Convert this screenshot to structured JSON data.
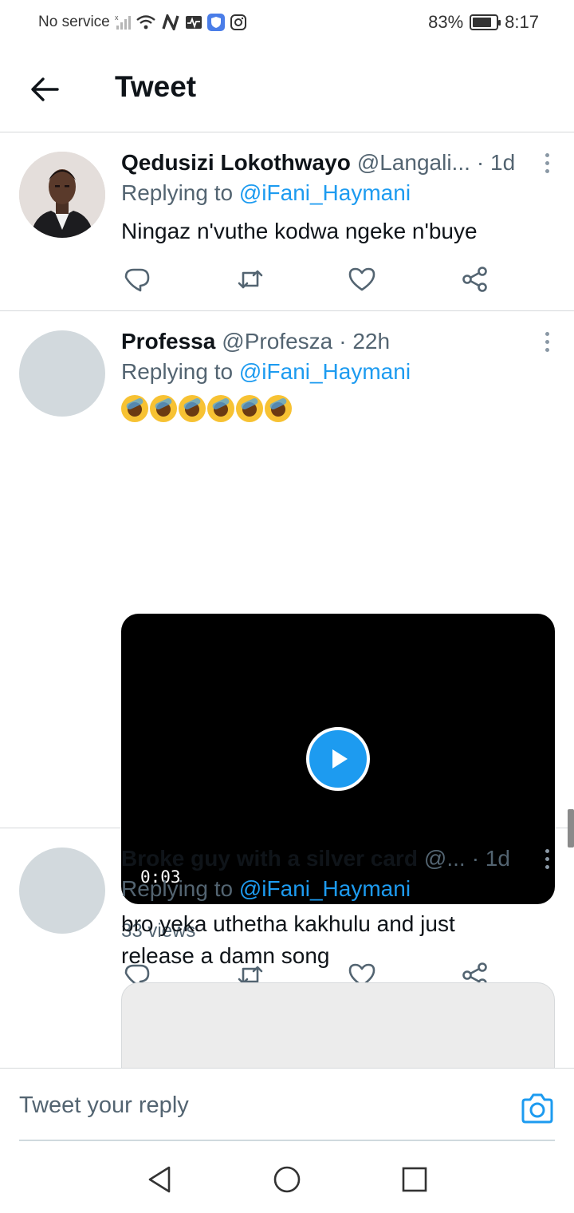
{
  "status_bar": {
    "carrier": "No service",
    "battery_text": "83%",
    "battery_level": 0.83,
    "time": "8:17",
    "icons": [
      "signal-icon",
      "wifi-icon",
      "nfc-icon",
      "activity-icon",
      "shield-app-icon",
      "instagram-icon",
      "battery-icon"
    ]
  },
  "header": {
    "title": "Tweet",
    "back_icon": "back-arrow-icon"
  },
  "replies": [
    {
      "display_name": "Qedusizi Lokothwayo",
      "handle": "@Langali...",
      "time": "· 1d",
      "replying_prefix": "Replying to",
      "replying_to": "@iFani_Haymani",
      "text": "Ningaz n'vuthe kodwa ngeke n'buye",
      "has_photo_avatar": true
    },
    {
      "display_name": "Professa",
      "handle": "@Profesza",
      "time": "· 22h",
      "replying_prefix": "Replying to",
      "replying_to": "@iFani_Haymani",
      "emoji_name": "rolling-on-the-floor-laughing-emoji",
      "emoji_count": 6,
      "video_duration": "0:03",
      "views": "33 views"
    },
    {
      "display_name": "Broke guy with a silver card",
      "handle": "@...",
      "time": "· 1d",
      "replying_prefix": "Replying to",
      "replying_to": "@iFani_Haymani",
      "text_line1": "bro yeka uthetha kakhulu and just",
      "text_line2": "release a damn song"
    }
  ],
  "actions": [
    "reply-icon",
    "retweet-icon",
    "like-icon",
    "share-icon"
  ],
  "composer": {
    "placeholder": "Tweet your reply",
    "camera_icon": "camera-icon"
  },
  "navbar": [
    "nav-back-icon",
    "nav-home-icon",
    "nav-recents-icon"
  ],
  "colors": {
    "accent": "#1d9bf0",
    "text_primary": "#0f1419",
    "text_secondary": "#536471",
    "divider": "#d6d9db"
  }
}
